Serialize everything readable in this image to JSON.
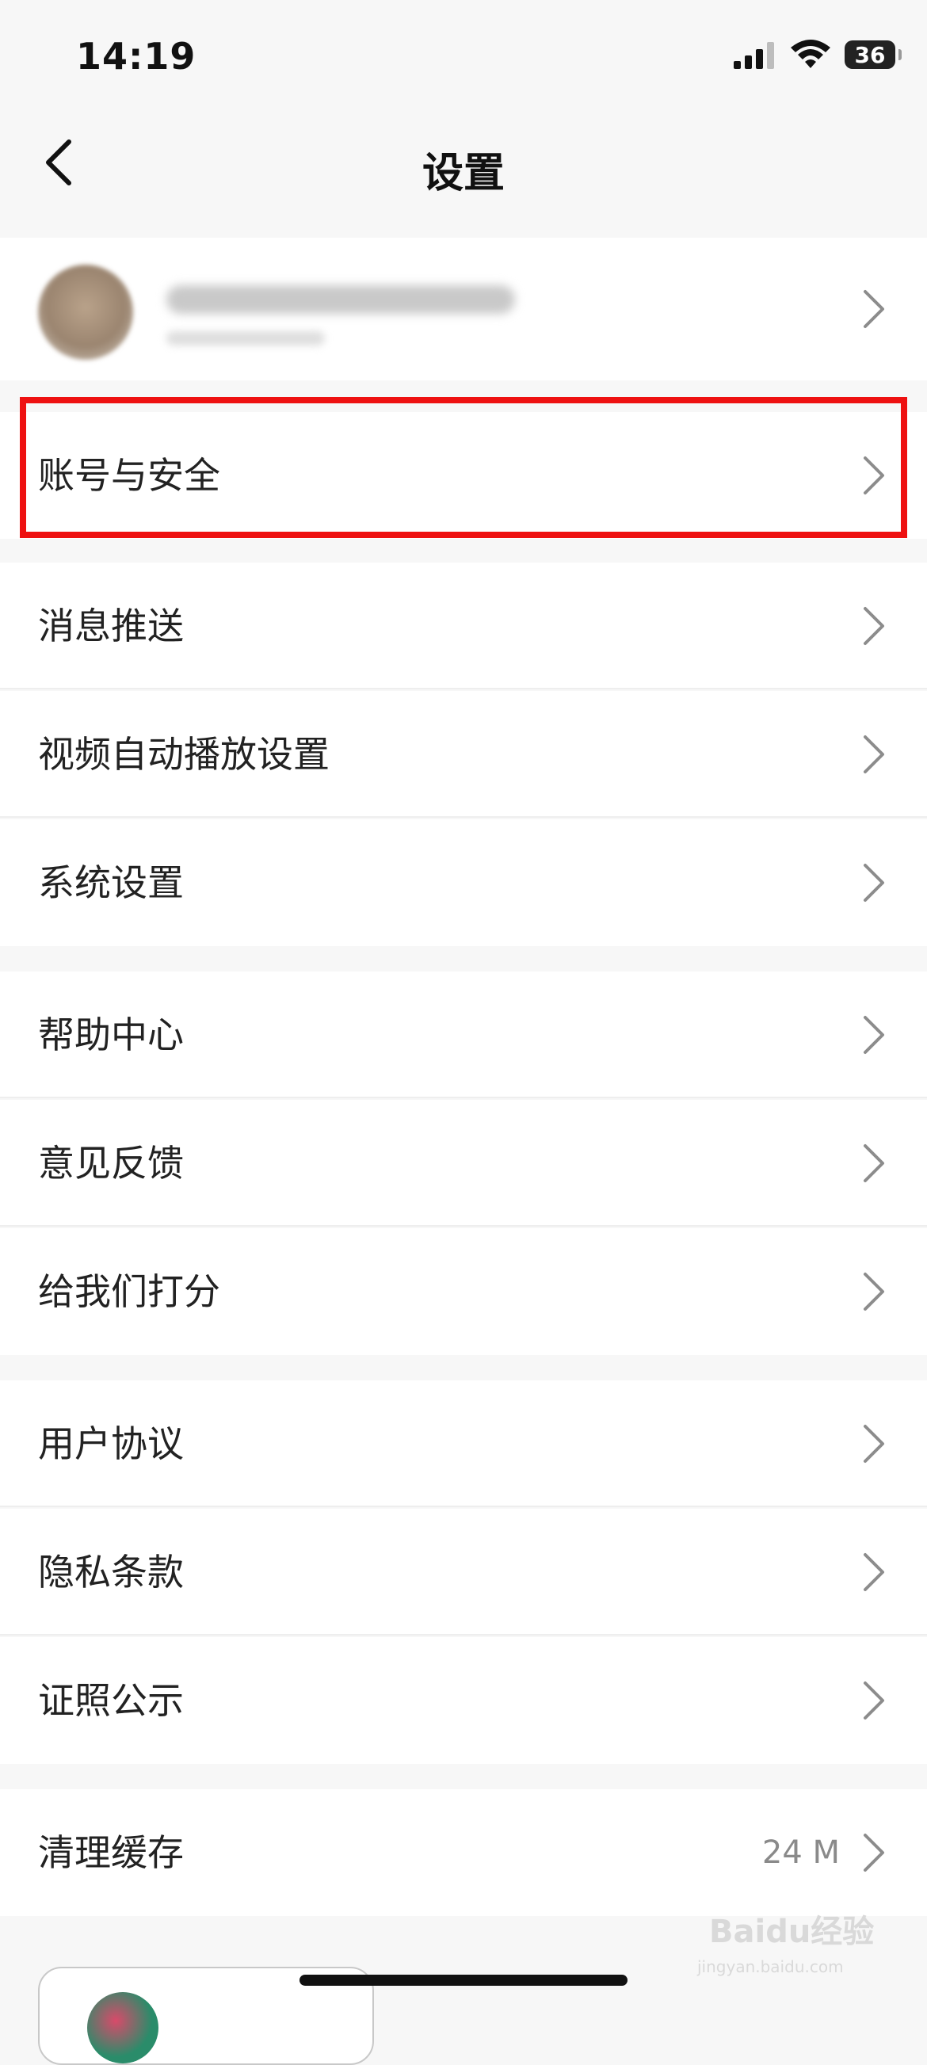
{
  "status_bar": {
    "time": "14:19",
    "battery": "36"
  },
  "nav": {
    "title": "设置",
    "back_icon": "chevron-left-icon"
  },
  "profile": {
    "chevron_icon": "chevron-right-icon"
  },
  "rows": {
    "account_security": "账号与安全",
    "message_push": "消息推送",
    "video_autoplay": "视频自动播放设置",
    "system_settings": "系统设置",
    "help_center": "帮助中心",
    "feedback": "意见反馈",
    "rate_us": "给我们打分",
    "user_agreement": "用户协议",
    "privacy_policy": "隐私条款",
    "licenses": "证照公示",
    "clear_cache": "清理缓存"
  },
  "cache_size": "24 M",
  "watermark": {
    "main": "Baidu经验",
    "sub": "jingyan.baidu.com"
  },
  "colors": {
    "highlight": "#ee1111",
    "background": "#f7f7f7",
    "row": "#ffffff"
  }
}
